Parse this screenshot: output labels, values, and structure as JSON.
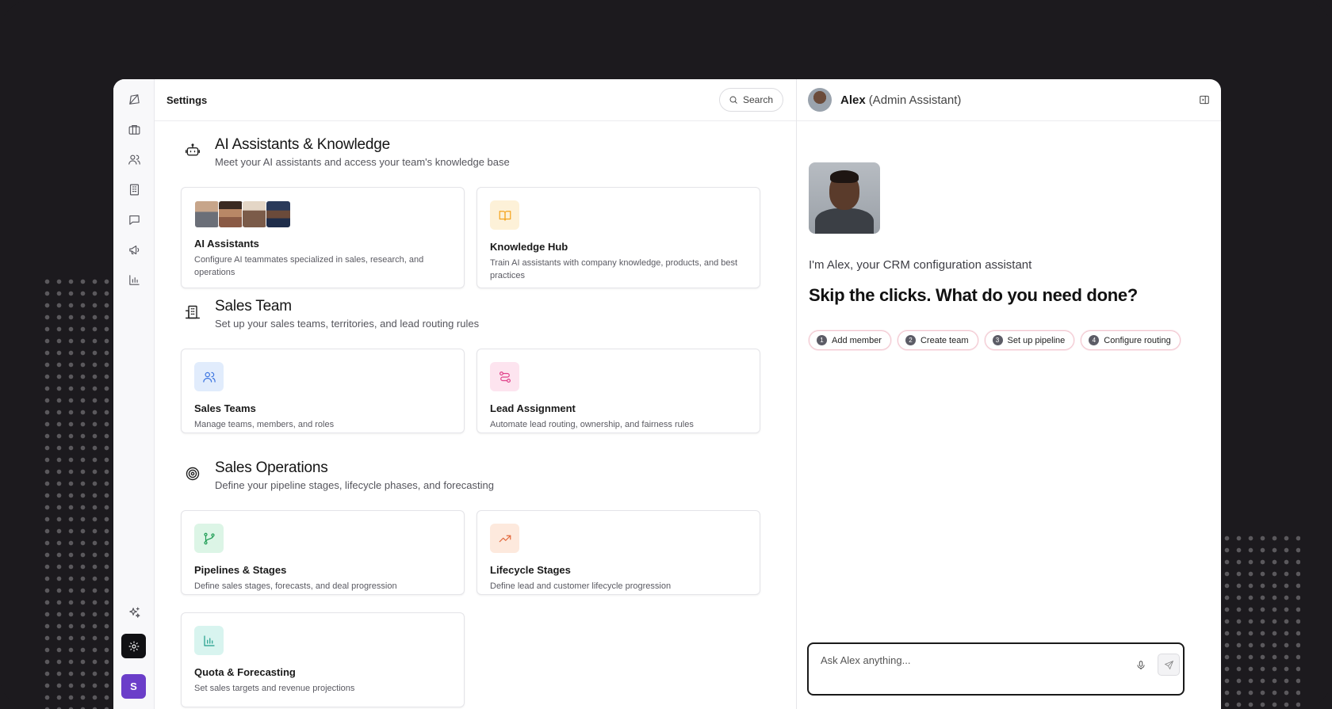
{
  "header": {
    "title": "Settings",
    "search_label": "Search"
  },
  "sections": [
    {
      "title": "AI Assistants & Knowledge",
      "subtitle": "Meet your AI assistants and access your team's knowledge base",
      "icon": "bot-icon",
      "cards": [
        {
          "title": "AI Assistants",
          "description": "Configure AI teammates specialized in sales, research, and operations",
          "icon": "avatar-stack"
        },
        {
          "title": "Knowledge Hub",
          "description": "Train AI assistants with company knowledge, products, and best practices",
          "icon": "book-icon",
          "color": "#f4a31c",
          "bg": "#fdf1d8"
        }
      ]
    },
    {
      "title": "Sales Team",
      "subtitle": "Set up your sales teams, territories, and lead routing rules",
      "icon": "building-icon",
      "cards": [
        {
          "title": "Sales Teams",
          "description": "Manage teams, members, and roles",
          "icon": "users-icon",
          "color": "#3b74e0",
          "bg": "#e1ecfc"
        },
        {
          "title": "Lead Assignment",
          "description": "Automate lead routing, ownership, and fairness rules",
          "icon": "route-icon",
          "color": "#e0418a",
          "bg": "#fde4ef"
        }
      ]
    },
    {
      "title": "Sales Operations",
      "subtitle": "Define your pipeline stages, lifecycle phases, and forecasting",
      "icon": "target-icon",
      "cards": [
        {
          "title": "Pipelines & Stages",
          "description": "Define sales stages, forecasts, and deal progression",
          "icon": "branch-icon",
          "color": "#1f9d55",
          "bg": "#dcf5e6"
        },
        {
          "title": "Lifecycle Stages",
          "description": "Define lead and customer lifecycle progression",
          "icon": "trend-icon",
          "color": "#e2673b",
          "bg": "#fde9dd"
        },
        {
          "title": "Quota & Forecasting",
          "description": "Set sales targets and revenue projections",
          "icon": "bar-chart-icon",
          "color": "#1f9d8a",
          "bg": "#d8f4ef"
        }
      ]
    }
  ],
  "rail": {
    "avatar_letter": "S"
  },
  "chat": {
    "name": "Alex",
    "role": "(Admin Assistant)",
    "intro": "I'm Alex, your CRM configuration assistant",
    "headline": "Skip the clicks. What do you need done?",
    "chips": [
      {
        "num": "1",
        "label": "Add member"
      },
      {
        "num": "2",
        "label": "Create team"
      },
      {
        "num": "3",
        "label": "Set up pipeline"
      },
      {
        "num": "4",
        "label": "Configure routing"
      }
    ],
    "input_placeholder": "Ask Alex anything..."
  }
}
